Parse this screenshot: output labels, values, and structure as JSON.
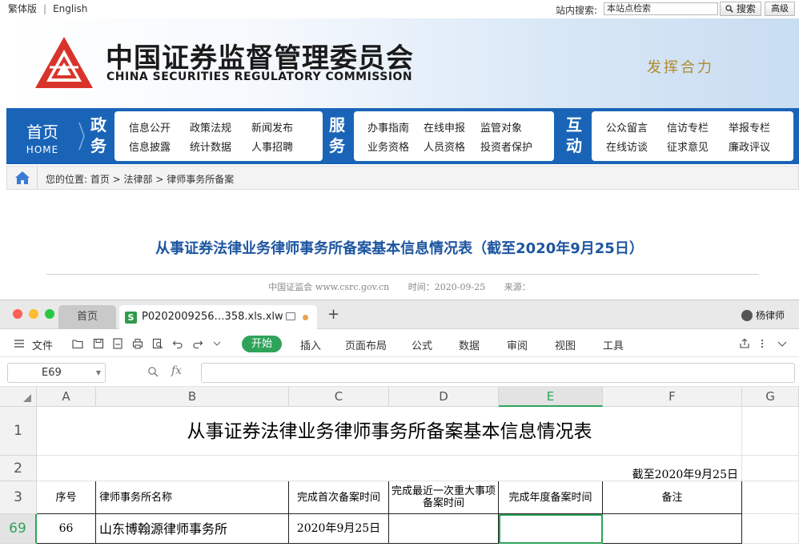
{
  "topbar": {
    "lang_traditional": "繁体版",
    "lang_sep": "|",
    "lang_english": "English",
    "search_label": "站内搜索:",
    "search_value": "本站点检索",
    "search_button": "搜索",
    "advanced_button": "高级"
  },
  "banner": {
    "cn_name": "中国证券监督管理委员会",
    "en_name": "CHINA SECURITIES REGULATORY COMMISSION",
    "slogan": "发挥合力"
  },
  "nav": {
    "home_cn": "首页",
    "home_en": "HOME",
    "sections": [
      {
        "label": "政务",
        "links": [
          "信息公开",
          "政策法规",
          "新闻发布",
          "信息披露",
          "统计数据",
          "人事招聘"
        ]
      },
      {
        "label": "服务",
        "links": [
          "办事指南",
          "在线申报",
          "监管对象",
          "业务资格",
          "人员资格",
          "投资者保护"
        ]
      },
      {
        "label": "互动",
        "links": [
          "公众留言",
          "信访专栏",
          "举报专栏",
          "在线访谈",
          "征求意见",
          "廉政评议"
        ]
      }
    ]
  },
  "breadcrumb": {
    "text": "您的位置: 首页 > 法律部 > 律师事务所备案"
  },
  "article": {
    "title": "从事证券法律业务律师事务所备案基本信息情况表（截至2020年9月25日）",
    "source": "中国证监会 www.csrc.gov.cn",
    "time": "时间：2020-09-25",
    "from": "来源："
  },
  "app": {
    "tab_home": "首页",
    "tab_file": "P0202009256…358.xls.xlw",
    "tab_add": "+",
    "user": "杨律师",
    "menu": [
      "文件",
      "开始",
      "插入",
      "页面布局",
      "公式",
      "数据",
      "审阅",
      "视图",
      "工具"
    ],
    "name_box": "E69",
    "fx_label": "fx"
  },
  "sheet": {
    "columns": [
      "A",
      "B",
      "C",
      "D",
      "E",
      "F",
      "G"
    ],
    "rows": [
      "1",
      "2",
      "3",
      "69"
    ],
    "title": "从事证券法律业务律师事务所备案基本信息情况表",
    "date": "截至2020年9月25日",
    "headers": [
      "序号",
      "律师事务所名称",
      "完成首次备案时间",
      "完成最近一次重大事项备案时间",
      "完成年度备案时间",
      "备注"
    ],
    "row69": [
      "66",
      "山东博翰源律师事务所",
      "2020年9月25日",
      "",
      "",
      ""
    ]
  },
  "colors": {
    "nav_blue": "#1a64b8",
    "title_blue": "#1d56a0",
    "accent_green": "#2fa35a",
    "logo_red": "#d9342b"
  }
}
